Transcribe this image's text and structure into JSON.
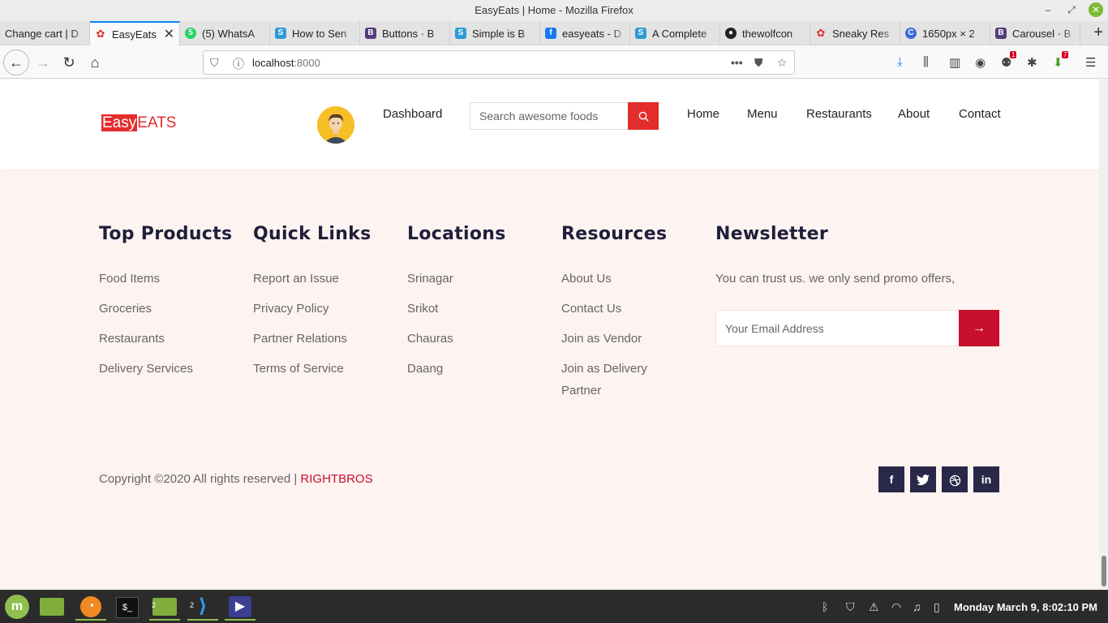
{
  "window": {
    "title": "EasyEats | Home - Mozilla Firefox"
  },
  "tabs": [
    {
      "label": "Change cart | D",
      "icon": "page-icon",
      "color": "#888888"
    },
    {
      "label": "EasyEats",
      "icon": "easyeats-favicon-icon",
      "color": "#e32d2d",
      "active": true
    },
    {
      "label": "(5) WhatsA",
      "icon": "whatsapp-icon",
      "color": "#25d366"
    },
    {
      "label": "How to Sen",
      "icon": "stackoverflow-icon",
      "color": "#2e9bd6"
    },
    {
      "label": "Buttons · B",
      "icon": "bootstrap-icon",
      "color": "#563d7c"
    },
    {
      "label": "Simple is B",
      "icon": "stackoverflow-icon",
      "color": "#2e9bd6"
    },
    {
      "label": "easyeats - D",
      "icon": "facebook-icon",
      "color": "#1877f2"
    },
    {
      "label": "A Complete",
      "icon": "stackoverflow-icon",
      "color": "#2e9bd6"
    },
    {
      "label": "thewolfcon",
      "icon": "github-icon",
      "color": "#222222"
    },
    {
      "label": "Sneaky Res",
      "icon": "easyeats-favicon-icon",
      "color": "#e32d2d"
    },
    {
      "label": "1650px × 2",
      "icon": "image-icon",
      "color": "#3b6cd9"
    },
    {
      "label": "Carousel · B",
      "icon": "bootstrap-icon",
      "color": "#563d7c"
    }
  ],
  "urlbar": {
    "host": "localhost",
    "port": ":8000"
  },
  "toolbar": {
    "badge_1": "1",
    "badge_2": "7"
  },
  "site": {
    "logo_easy": "Easy",
    "logo_eats": "EATS",
    "dashboard": "Dashboard",
    "search_placeholder": "Search awesome foods",
    "nav": [
      "Home",
      "Menu",
      "Restaurants",
      "About",
      "Contact"
    ]
  },
  "footer": {
    "columns": [
      {
        "title": "Top Products",
        "links": [
          "Food Items",
          "Groceries",
          "Restaurants",
          "Delivery Services"
        ]
      },
      {
        "title": "Quick Links",
        "links": [
          "Report an Issue",
          "Privacy Policy",
          "Partner Relations",
          "Terms of Service"
        ]
      },
      {
        "title": "Locations",
        "links": [
          "Srinagar",
          "Srikot",
          "Chauras",
          "Daang"
        ]
      },
      {
        "title": "Resources",
        "links": [
          "About Us",
          "Contact Us",
          "Join as Vendor",
          "Join as Delivery Partner"
        ]
      }
    ],
    "newsletter": {
      "title": "Newsletter",
      "text": "You can trust us. we only send promo offers,",
      "placeholder": "Your Email Address"
    },
    "copyright": "Copyright ©2020 All rights reserved |",
    "brand": "RIGHTBROS",
    "social": [
      "f",
      "t",
      "d",
      "in"
    ]
  },
  "taskbar": {
    "clock": "Monday March  9,  8:02:10 PM",
    "badge_files": "2",
    "badge_code": "2"
  }
}
